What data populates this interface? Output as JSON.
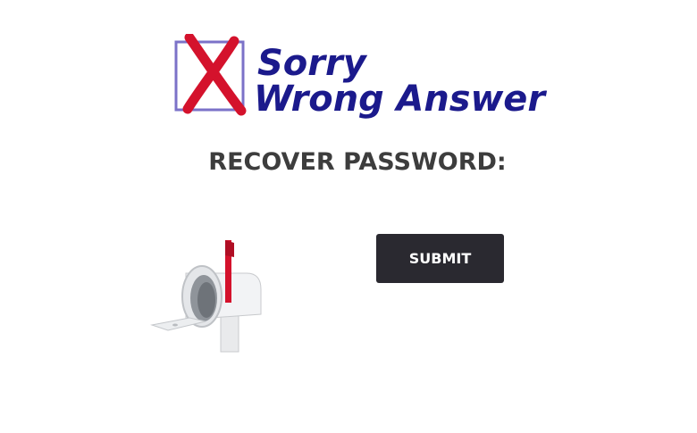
{
  "logo": {
    "line1": "Sorry",
    "line2": "Wrong Answer"
  },
  "page": {
    "heading": "RECOVER PASSWORD:"
  },
  "form": {
    "submit_label": "SUBMIT"
  },
  "icons": {
    "logo_mark": "x-mark-icon",
    "mailbox": "mailbox-icon"
  },
  "colors": {
    "logo_text": "#1b1a8c",
    "logo_x": "#d4122c",
    "logo_box": "#7b72c8",
    "heading": "#3d3d3d",
    "button_bg": "#2a2930",
    "button_text": "#ffffff"
  }
}
